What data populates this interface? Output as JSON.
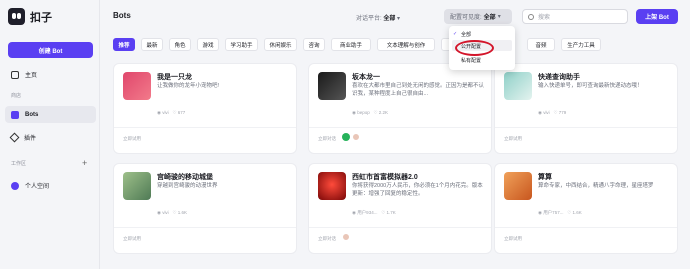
{
  "sidebar": {
    "logo_text": "扣子",
    "create_button": "创建 Bot",
    "home": "主页",
    "store_section": "商店",
    "bots": "Bots",
    "plugins": "插件",
    "workspace_section": "工作区",
    "personal_space": "个人空间"
  },
  "header": {
    "title": "Bots",
    "platform_label": "对话平台:",
    "platform_value": "全部",
    "visibility_label": "配置可见度:",
    "visibility_value": "全部",
    "search_placeholder": "搜索",
    "publish_button": "上架 Bot"
  },
  "tabs": [
    "推荐",
    "最新",
    "角色",
    "游戏",
    "学习助手",
    "休闲娱乐",
    "咨询",
    "商业助手",
    "文本理解与创作",
    "图像与音频",
    "音频",
    "生产力工具"
  ],
  "dropdown": {
    "options": [
      "全部",
      "公开配置",
      "私有配置"
    ]
  },
  "cards": [
    {
      "title": "我是一只龙",
      "desc": "让我做你的龙年小宠物吧!",
      "author": "vivi",
      "stats": "677",
      "footer": "立即试用",
      "img_color": "#e0476c"
    },
    {
      "title": "坂本龙一",
      "desc": "喜欢在大都市里自己到处无闲的感觉。正因为是都不认识我，某种程度上自己很自由...",
      "author": "bepop",
      "stats": "2.2K",
      "footer": "立即对话",
      "img_color": "#2a2a2a"
    },
    {
      "title": "快递查询助手",
      "desc": "输入快递单号，即可查询最新快递动态哦！",
      "author": "vivi",
      "stats": "779",
      "footer": "立即试用",
      "img_color": "#8fd0c8"
    },
    {
      "title": "宫崎骏的移动城堡",
      "desc": "穿越到宫崎骏的动漫世界",
      "author": "vivi",
      "stats": "1.6K",
      "footer": "立即试用",
      "img_color": "#6e9a6b"
    },
    {
      "title": "西虹市首富模拟器2.0",
      "desc": "你将获得2000万人民币，你必须在1个月内花完。版本更新：增强了回复的稳定性。",
      "author": "用户934...",
      "stats": "1.7K",
      "footer": "立即对话",
      "img_color": "#c21313"
    },
    {
      "title": "算算",
      "desc": "算命专家，中西结合，精通八字命理，星座塔罗",
      "author": "用户757...",
      "stats": "1.6K",
      "footer": "立即试用",
      "img_color": "#e58a3b"
    }
  ]
}
